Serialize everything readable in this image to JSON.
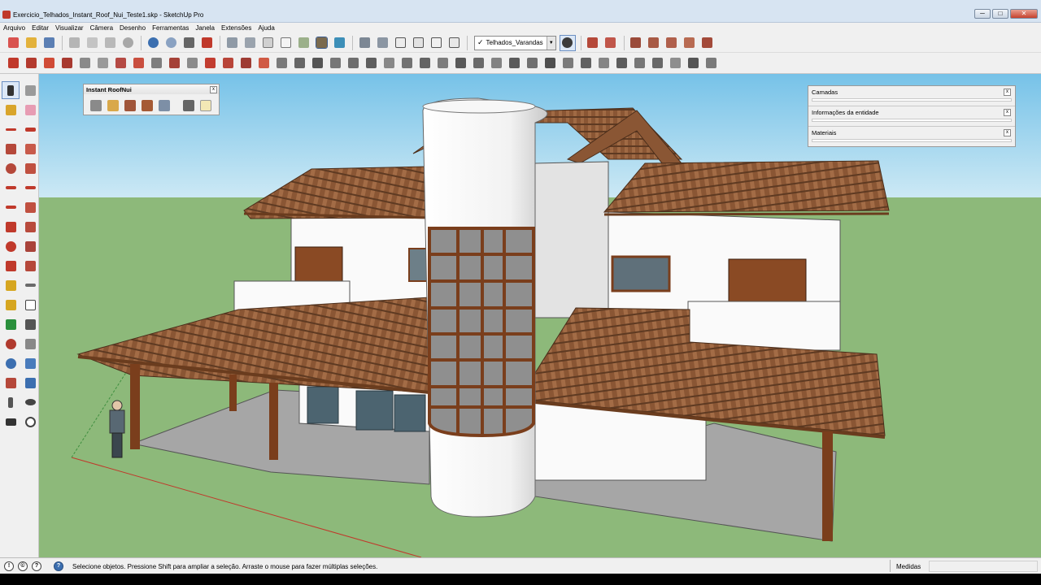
{
  "window": {
    "title": "Exercicio_Telhados_Instant_Roof_Nui_Teste1.skp - SketchUp Pro",
    "minimize": "─",
    "maximize": "□",
    "close": "✕"
  },
  "menu": [
    "Arquivo",
    "Editar",
    "Visualizar",
    "Câmera",
    "Desenho",
    "Ferramentas",
    "Janela",
    "Extensões",
    "Ajuda"
  ],
  "scene_selector": {
    "check": "✓",
    "label": "Telhados_Varandas",
    "arrow": "▼"
  },
  "floating_toolbar": {
    "title": "Instant RoofNui",
    "close": "x"
  },
  "tray": {
    "close": "x",
    "panels": [
      "Camadas",
      "Informações da entidade",
      "Materiais"
    ]
  },
  "status": {
    "text": "Selecione objetos. Pressione Shift para ampliar a seleção. Arraste o mouse para fazer múltiplas seleções.",
    "measurements_label": "Medidas",
    "icon_info": "!",
    "icon_credit": "©",
    "icon_help": "?"
  },
  "colors": {
    "sky": "#7cc6ea",
    "ground": "#8db97a",
    "roof": "#8a5634",
    "wall": "#fafafa",
    "wood": "#7a3e1c",
    "tower": "#f4f4f4",
    "floor": "#a6a6a6"
  }
}
